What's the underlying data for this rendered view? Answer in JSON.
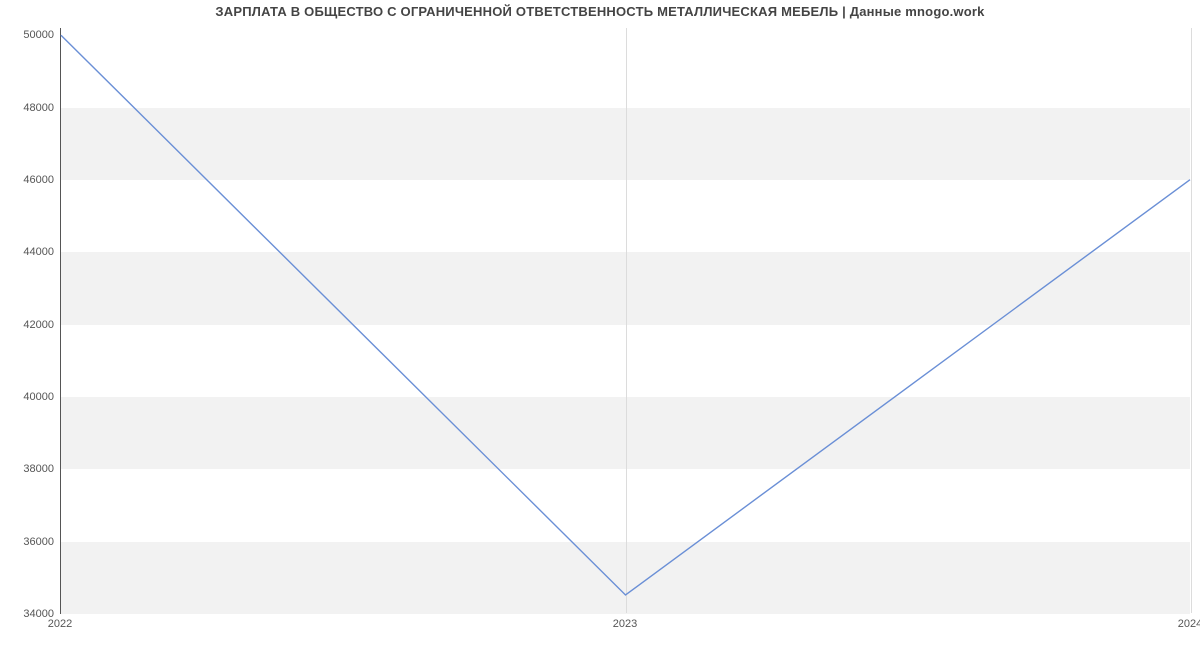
{
  "chart_data": {
    "type": "line",
    "title": "ЗАРПЛАТА В ОБЩЕСТВО С ОГРАНИЧЕННОЙ ОТВЕТСТВЕННОСТЬ МЕТАЛЛИЧЕСКАЯ МЕБЕЛЬ | Данные mnogo.work",
    "xlabel": "",
    "ylabel": "",
    "x": [
      2022,
      2023,
      2024
    ],
    "values": [
      50000,
      34500,
      46000
    ],
    "x_ticks": [
      2022,
      2023,
      2024
    ],
    "y_ticks": [
      34000,
      36000,
      38000,
      40000,
      42000,
      44000,
      46000,
      48000,
      50000
    ],
    "xlim": [
      2022,
      2024
    ],
    "ylim": [
      34000,
      50200
    ],
    "line_color": "#6a8fd6",
    "band_color": "#f2f2f2"
  }
}
